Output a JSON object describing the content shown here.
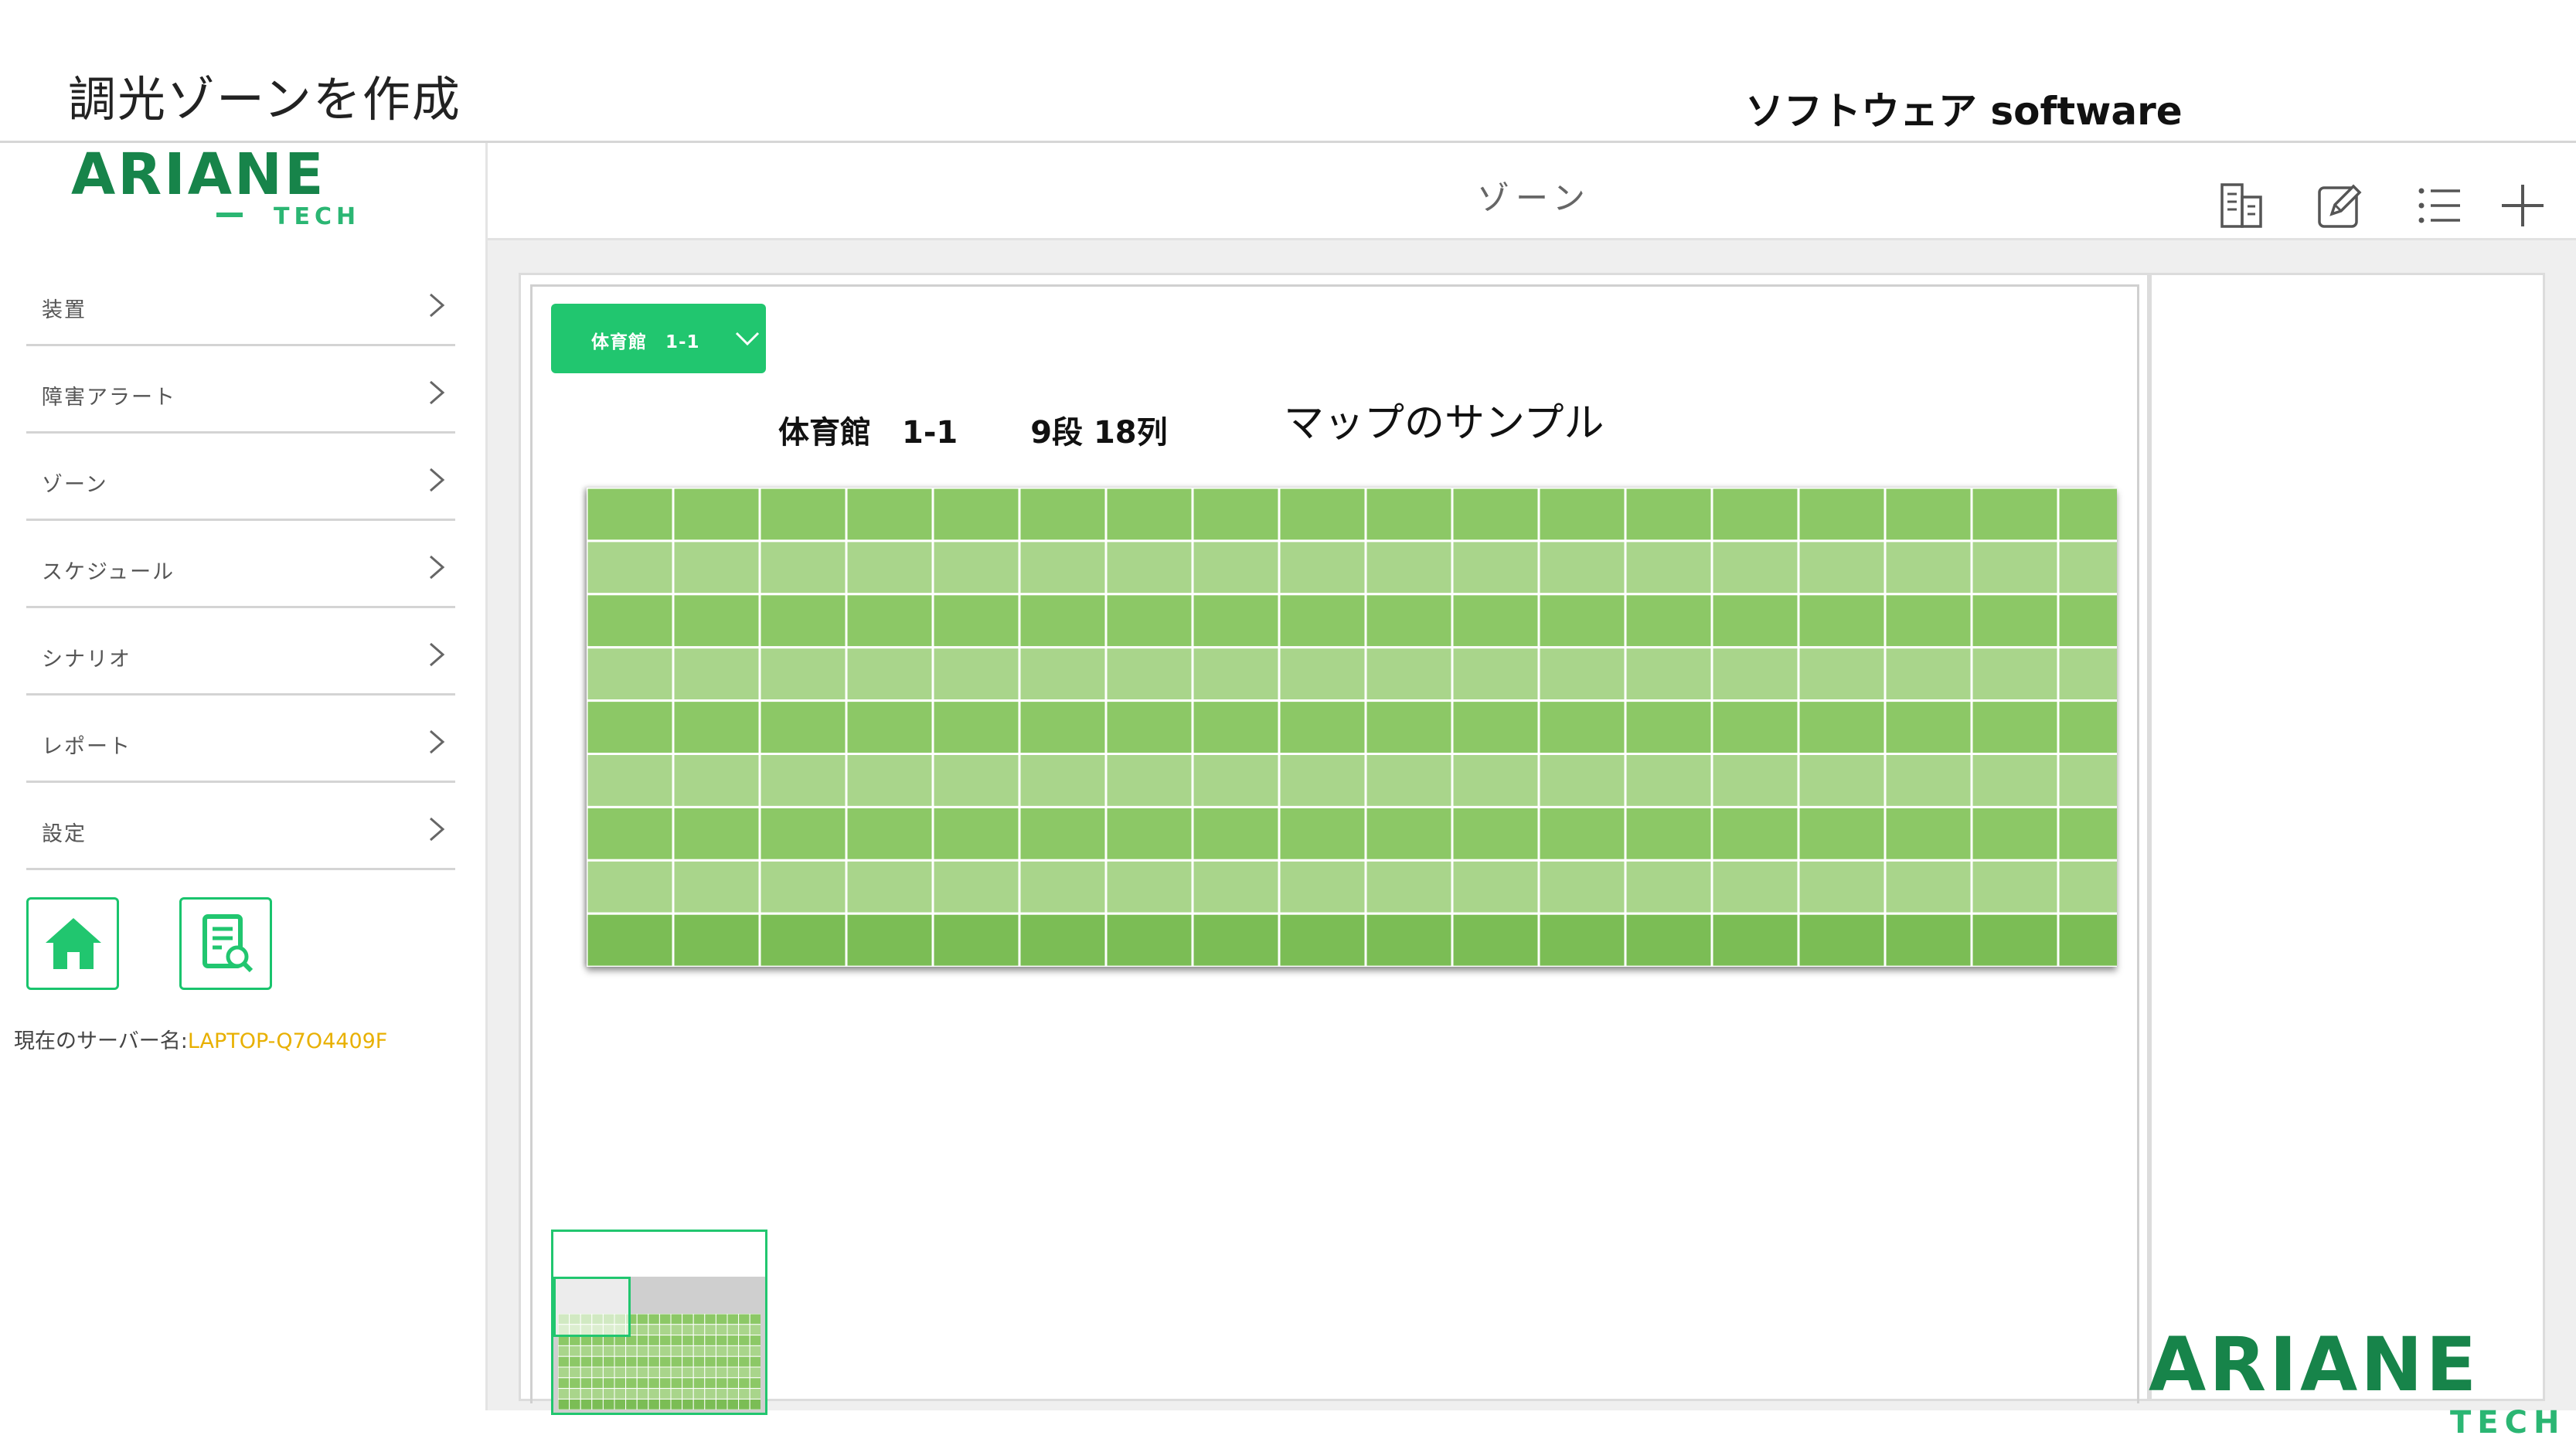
{
  "slide": {
    "title": "調光ゾーンを作成",
    "subtitle": "ソフトウェア software"
  },
  "brand": {
    "logo_text": "ARIANE",
    "logo_sub": "TECH",
    "primary_color": "#17844a",
    "accent_color": "#21c66f"
  },
  "sidebar": {
    "items": [
      {
        "label": "装置"
      },
      {
        "label": "障害アラート"
      },
      {
        "label": "ゾーン"
      },
      {
        "label": "スケジュール"
      },
      {
        "label": "シナリオ"
      },
      {
        "label": "レポート"
      },
      {
        "label": "設定"
      }
    ],
    "tiles": [
      {
        "icon": "home-icon"
      },
      {
        "icon": "document-search-icon"
      }
    ],
    "server_label": "現在のサーバー名:",
    "server_name": "LAPTOP-Q7O4409F"
  },
  "topbar": {
    "title": "ゾーン",
    "tools": [
      {
        "icon": "building-icon"
      },
      {
        "icon": "edit-icon"
      },
      {
        "icon": "list-icon"
      },
      {
        "icon": "plus-icon"
      }
    ]
  },
  "map": {
    "zone_select_value": "体育館　1-1",
    "heading_zone": "体育館　1-1",
    "heading_size": "9段 18列",
    "sample_label": "マップのサンプル",
    "rows": 9,
    "cols": 18
  }
}
